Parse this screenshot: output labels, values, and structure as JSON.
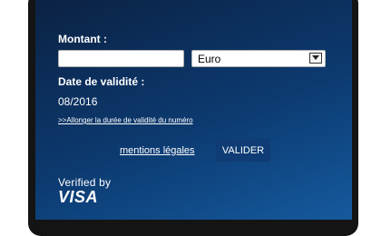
{
  "form": {
    "amount_label": "Montant :",
    "amount_value": "",
    "currency_selected": "Euro",
    "validity_label": "Date de validité :",
    "validity_value": "08/2016",
    "extend_link": ">>Allonger la durée de validité du numéro"
  },
  "footer": {
    "legal_link": "mentions légales",
    "validate_button": "VALIDER"
  },
  "logo": {
    "line1": "Verified by",
    "line2": "VISA"
  }
}
